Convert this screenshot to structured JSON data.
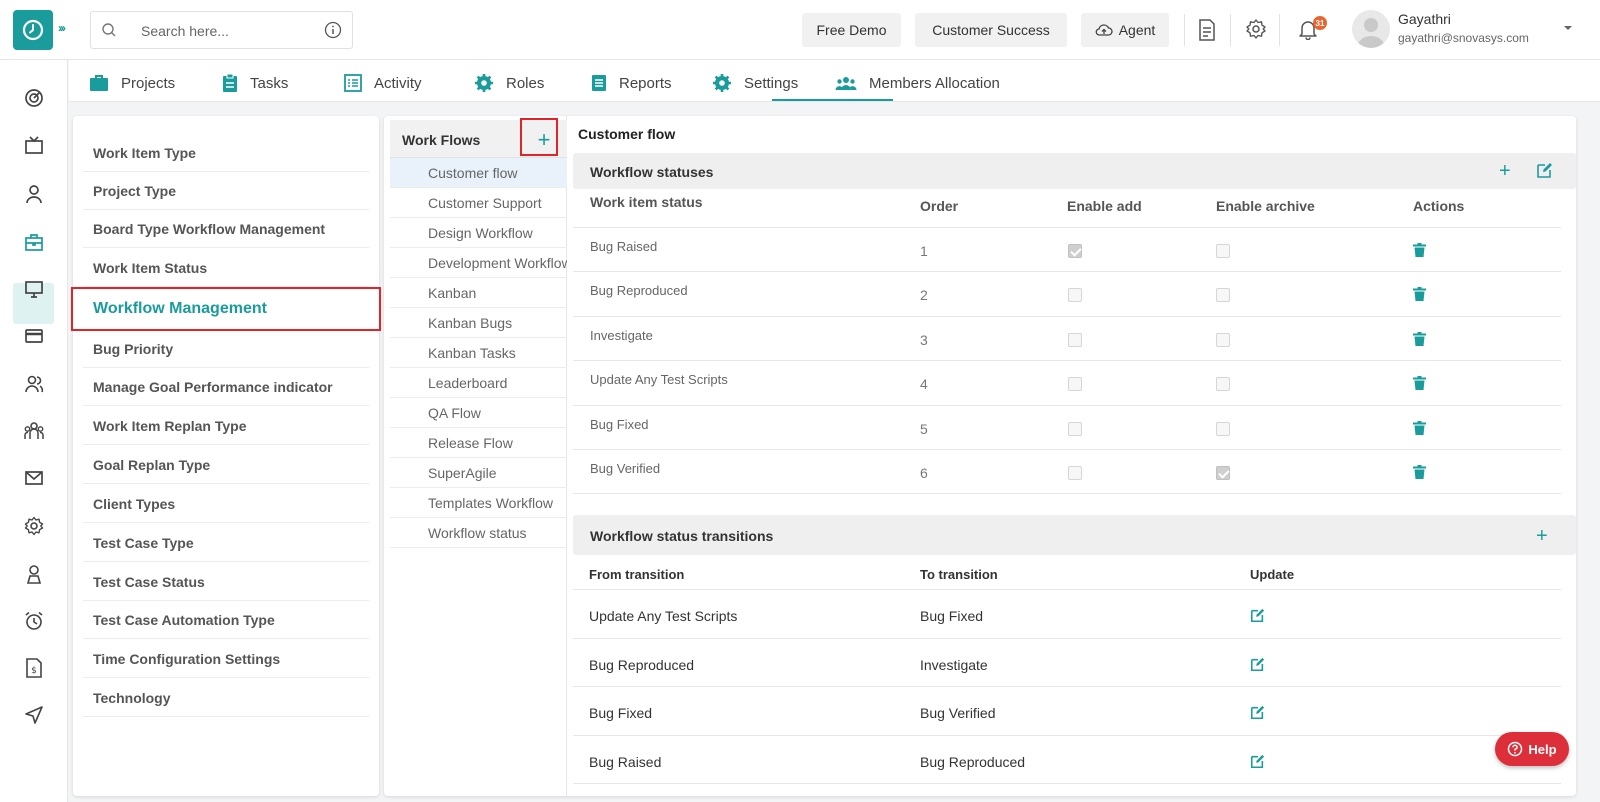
{
  "header": {
    "search_placeholder": "Search here...",
    "free_demo": "Free Demo",
    "customer_success": "Customer Success",
    "agent": "Agent",
    "notification_count": "31",
    "user_name": "Gayathri",
    "user_email": "gayathri@snovasys.com"
  },
  "nav": {
    "tabs": [
      {
        "label": "Projects",
        "icon": "briefcase-icon"
      },
      {
        "label": "Tasks",
        "icon": "clipboard-icon"
      },
      {
        "label": "Activity",
        "icon": "list-icon"
      },
      {
        "label": "Roles",
        "icon": "gear-icon"
      },
      {
        "label": "Reports",
        "icon": "document-icon"
      },
      {
        "label": "Settings",
        "icon": "gear-icon",
        "active": true
      },
      {
        "label": "Members Allocation",
        "icon": "people-icon"
      }
    ]
  },
  "settings_menu": {
    "items": [
      "Work Item Type",
      "Project Type",
      "Board Type Workflow Management",
      "Work Item Status",
      "Workflow Management",
      "Bug Priority",
      "Manage Goal Performance indicator",
      "Work Item Replan Type",
      "Goal Replan Type",
      "Client Types",
      "Test Case Type",
      "Test Case Status",
      "Test Case Automation Type",
      "Time Configuration Settings",
      "Technology"
    ],
    "active": "Workflow Management"
  },
  "workflows": {
    "title": "Work Flows",
    "add": "+",
    "items": [
      "Customer flow",
      "Customer Support",
      "Design Workflow",
      "Development Workflow",
      "Kanban",
      "Kanban Bugs",
      "Kanban Tasks",
      "Leaderboard",
      "QA Flow",
      "Release Flow",
      "SuperAgile",
      "Templates Workflow",
      "Workflow status"
    ],
    "active": "Customer flow"
  },
  "detail": {
    "title": "Customer flow",
    "statuses": {
      "heading": "Workflow statuses",
      "columns": [
        "Work item status",
        "Order",
        "Enable add",
        "Enable archive",
        "Actions"
      ],
      "rows": [
        {
          "status": "Bug Raised",
          "order": "1",
          "enable_add": true,
          "enable_archive": false
        },
        {
          "status": "Bug Reproduced",
          "order": "2",
          "enable_add": false,
          "enable_archive": false
        },
        {
          "status": "Investigate",
          "order": "3",
          "enable_add": false,
          "enable_archive": false
        },
        {
          "status": "Update Any Test Scripts",
          "order": "4",
          "enable_add": false,
          "enable_archive": false
        },
        {
          "status": "Bug Fixed",
          "order": "5",
          "enable_add": false,
          "enable_archive": false
        },
        {
          "status": "Bug Verified",
          "order": "6",
          "enable_add": false,
          "enable_archive": true
        }
      ]
    },
    "transitions": {
      "heading": "Workflow status transitions",
      "columns": [
        "From transition",
        "To transition",
        "Update"
      ],
      "rows": [
        {
          "from": "Update Any Test Scripts",
          "to": "Bug Fixed"
        },
        {
          "from": "Bug Reproduced",
          "to": "Investigate"
        },
        {
          "from": "Bug Fixed",
          "to": "Bug Verified"
        },
        {
          "from": "Bug Raised",
          "to": "Bug Reproduced"
        }
      ]
    }
  },
  "help": "Help",
  "colors": {
    "accent": "#1b9c9c",
    "highlight_border": "#e0242a",
    "help_button": "#dc2f3a"
  }
}
